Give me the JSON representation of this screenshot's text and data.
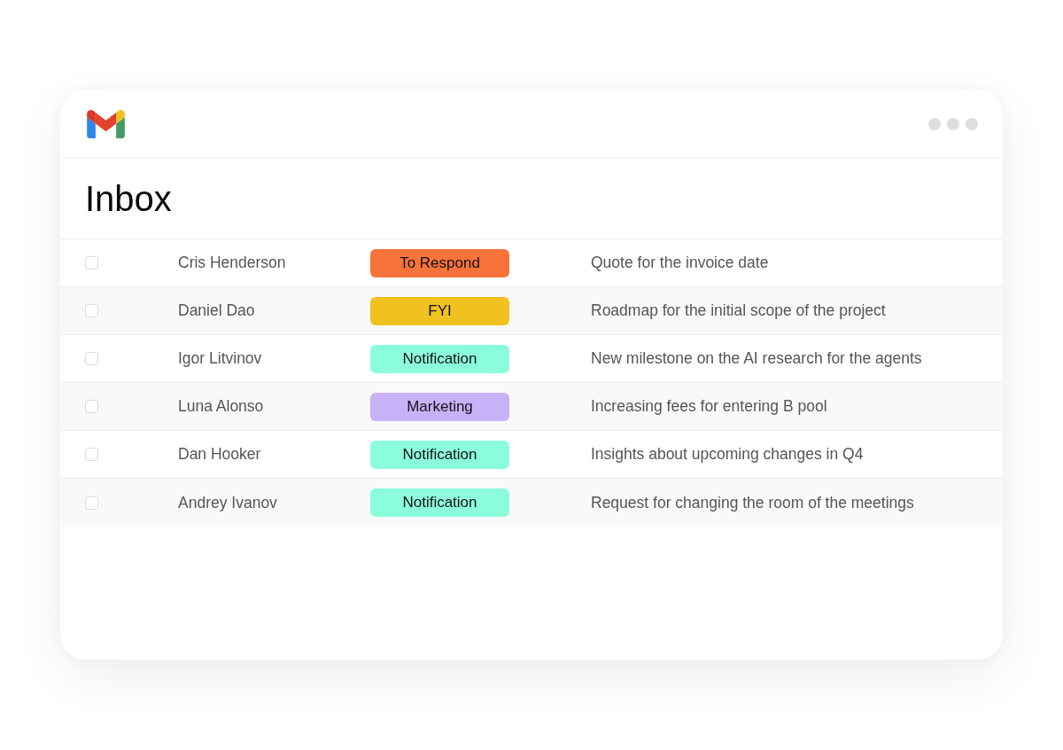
{
  "title": "Inbox",
  "emails": [
    {
      "checked": false,
      "sender": "Cris Henderson",
      "label": {
        "text": "To Respond",
        "color": "#f7733a"
      },
      "subject": "Quote for the invoice date"
    },
    {
      "checked": false,
      "sender": "Daniel Dao",
      "label": {
        "text": "FYI",
        "color": "#f1c21f"
      },
      "subject": "Roadmap for the initial scope of the project"
    },
    {
      "checked": false,
      "sender": "Igor Litvinov",
      "label": {
        "text": "Notification",
        "color": "#8cfddb"
      },
      "subject": "New milestone on the AI research for the agents"
    },
    {
      "checked": false,
      "sender": "Luna Alonso",
      "label": {
        "text": "Marketing",
        "color": "#c9b1f8"
      },
      "subject": "Increasing fees for entering B pool"
    },
    {
      "checked": false,
      "sender": "Dan Hooker",
      "label": {
        "text": "Notification",
        "color": "#8cfddb"
      },
      "subject": "Insights about upcoming changes in Q4"
    },
    {
      "checked": false,
      "sender": "Andrey Ivanov",
      "label": {
        "text": "Notification",
        "color": "#8cfddb"
      },
      "subject": "Request for changing the room of the meetings"
    }
  ]
}
